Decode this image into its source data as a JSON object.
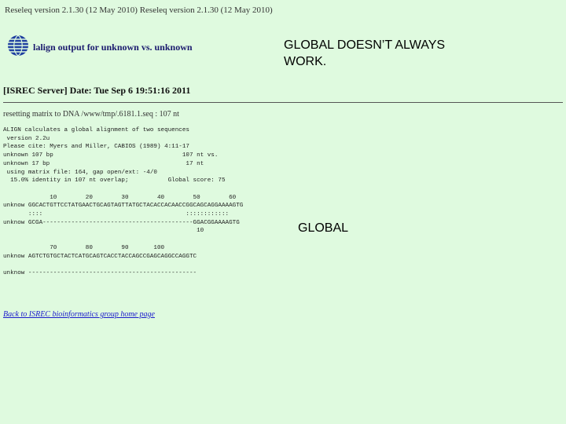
{
  "header": {
    "version_line": "Reseleq version 2.1.30 (12 May 2010) Reseleq version 2.1.30 (12 May 2010)",
    "heading": "lalign output for unknown vs. unknown",
    "server_line": "[ISREC Server] Date: Tue Sep 6 19:51:16 2011",
    "matrix_line": "resetting matrix to DNA /www/tmp/.6181.1.seq : 107 nt"
  },
  "output": {
    "lines": [
      "ALIGN calculates a global alignment of two sequences",
      " version 2.2u",
      "Please cite: Myers and Miller, CABIOS (1989) 4:11-17",
      "unknown 107 bp                                    107 nt vs.",
      "unknown 17 bp                                      17 nt",
      " using matrix file: 164, gap open/ext: -4/0",
      "  15.0% identity in 107 nt overlap;           Global score: 75",
      "",
      "             10        20        30        40        50        60",
      "unknow GGCACTGTTCCTATGAACTGCAGTAGTTATGCTACACCACAACCGGCAGCAGGAAAAGTG",
      "       ::::                                        ::::::::::::",
      "unknow GCGA------------------------------------------GGACGGAAAAGTG",
      "                                                      10",
      "",
      "             70        80        90       100",
      "unknow AGTCTGTGCTACTCATGCAGTCACCTACCAGCCGAGCAGGCCAGGTC",
      "",
      "unknow -----------------------------------------------"
    ],
    "home_link": "Back to ISREC bioinformatics group home page"
  },
  "annotations": {
    "title": "GLOBAL DOESN’T ALWAYS WORK.",
    "global_label": "GLOBAL"
  }
}
